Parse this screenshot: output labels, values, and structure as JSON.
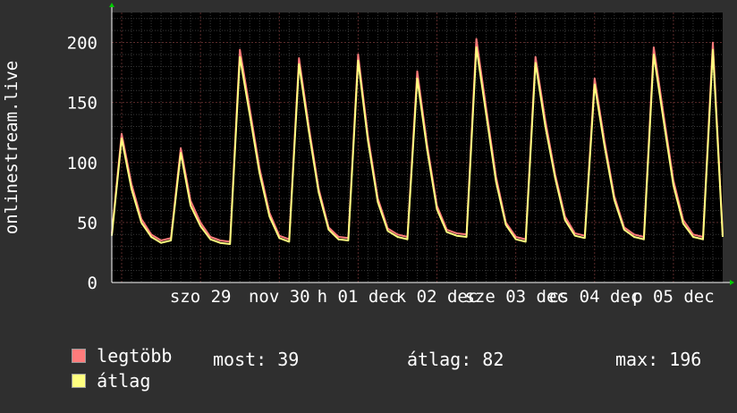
{
  "chart_data": {
    "type": "line",
    "ylabel": "onlinestream.live",
    "ylim": [
      0,
      225
    ],
    "yticks": [
      "0",
      "50",
      "100",
      "150",
      "200"
    ],
    "xticks": [
      {
        "label": "szo 29",
        "x": 1.125
      },
      {
        "label": "nov 30",
        "x": 2.125
      },
      {
        "label": "h 01 dec",
        "x": 3.125
      },
      {
        "label": "k 02 dec",
        "x": 4.125
      },
      {
        "label": "sze 03 dec",
        "x": 5.125
      },
      {
        "label": "cs 04 dec",
        "x": 6.125
      },
      {
        "label": "p 05 dec",
        "x": 7.125
      }
    ],
    "xlim": [
      0,
      7.75
    ],
    "x": [
      0.0,
      0.125,
      0.25,
      0.375,
      0.5,
      0.625,
      0.75,
      0.875,
      1.0,
      1.125,
      1.25,
      1.375,
      1.5,
      1.625,
      1.75,
      1.875,
      2.0,
      2.125,
      2.25,
      2.375,
      2.5,
      2.625,
      2.75,
      2.875,
      3.0,
      3.125,
      3.25,
      3.375,
      3.5,
      3.625,
      3.75,
      3.875,
      4.0,
      4.125,
      4.25,
      4.375,
      4.5,
      4.625,
      4.75,
      4.875,
      5.0,
      5.125,
      5.25,
      5.375,
      5.5,
      5.625,
      5.75,
      5.875,
      6.0,
      6.125,
      6.25,
      6.375,
      6.5,
      6.625,
      6.75,
      6.875,
      7.0,
      7.125,
      7.25,
      7.375,
      7.5,
      7.625,
      7.75
    ],
    "series": [
      {
        "name": "legtöbb",
        "color": "#ff7b7b",
        "values": [
          41,
          124,
          82,
          53,
          40,
          35,
          37,
          112,
          68,
          50,
          38,
          35,
          34,
          194,
          145,
          95,
          58,
          39,
          36,
          187,
          130,
          78,
          46,
          38,
          37,
          190,
          122,
          70,
          45,
          40,
          38,
          176,
          115,
          64,
          44,
          41,
          40,
          203,
          145,
          88,
          50,
          38,
          36,
          188,
          135,
          90,
          55,
          41,
          39,
          170,
          118,
          72,
          46,
          40,
          38,
          196,
          140,
          85,
          52,
          40,
          38,
          200,
          40
        ]
      },
      {
        "name": "átlag",
        "color": "#ffff80",
        "values": [
          39,
          120,
          78,
          50,
          38,
          33,
          35,
          108,
          64,
          47,
          36,
          33,
          32,
          188,
          140,
          91,
          55,
          37,
          34,
          182,
          126,
          75,
          44,
          36,
          35,
          185,
          118,
          67,
          43,
          38,
          36,
          170,
          111,
          61,
          42,
          39,
          38,
          196,
          140,
          84,
          48,
          36,
          34,
          183,
          130,
          87,
          52,
          39,
          37,
          165,
          114,
          69,
          44,
          38,
          36,
          190,
          135,
          81,
          49,
          38,
          36,
          194,
          38
        ]
      }
    ],
    "grid": true,
    "background": "#000000"
  },
  "legend": {
    "items": [
      {
        "label": "legtöbb",
        "color": "#ff7b7b"
      },
      {
        "label": "átlag",
        "color": "#ffff80"
      }
    ]
  },
  "stats": {
    "most": "most: 39",
    "atlag": "átlag: 82",
    "max": "max: 196"
  }
}
